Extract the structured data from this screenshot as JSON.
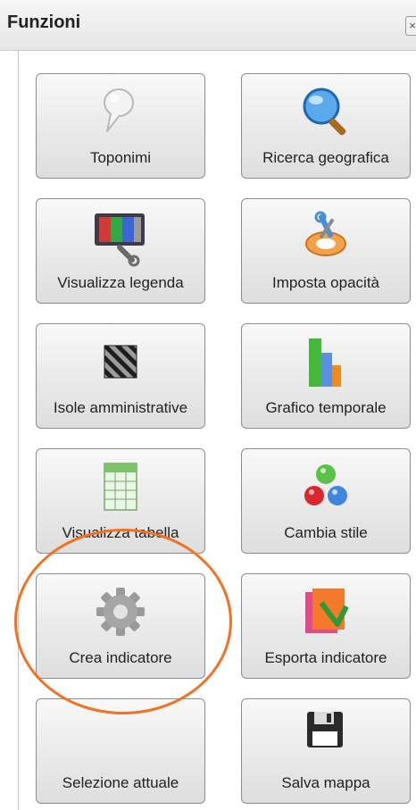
{
  "panel": {
    "title": "Funzioni",
    "close_glyph": "×"
  },
  "tiles": [
    {
      "label": "Toponimi",
      "icon": "pin-icon"
    },
    {
      "label": "Ricerca geografica",
      "icon": "magnifier-icon"
    },
    {
      "label": "Visualizza legenda",
      "icon": "legend-monitor-icon"
    },
    {
      "label": "Imposta opacità",
      "icon": "opacity-tools-icon"
    },
    {
      "label": "Isole amministrative",
      "icon": "hatched-square-icon"
    },
    {
      "label": "Grafico temporale",
      "icon": "bar-chart-icon"
    },
    {
      "label": "Visualizza tabella",
      "icon": "table-sheet-icon"
    },
    {
      "label": "Cambia stile",
      "icon": "color-balls-icon"
    },
    {
      "label": "Crea indicatore",
      "icon": "gear-icon"
    },
    {
      "label": "Esporta indicatore",
      "icon": "export-folder-icon"
    },
    {
      "label": "Selezione attuale",
      "icon": "blank-icon"
    },
    {
      "label": "Salva mappa",
      "icon": "floppy-disk-icon"
    }
  ],
  "colors": {
    "highlight": "#f07222"
  }
}
